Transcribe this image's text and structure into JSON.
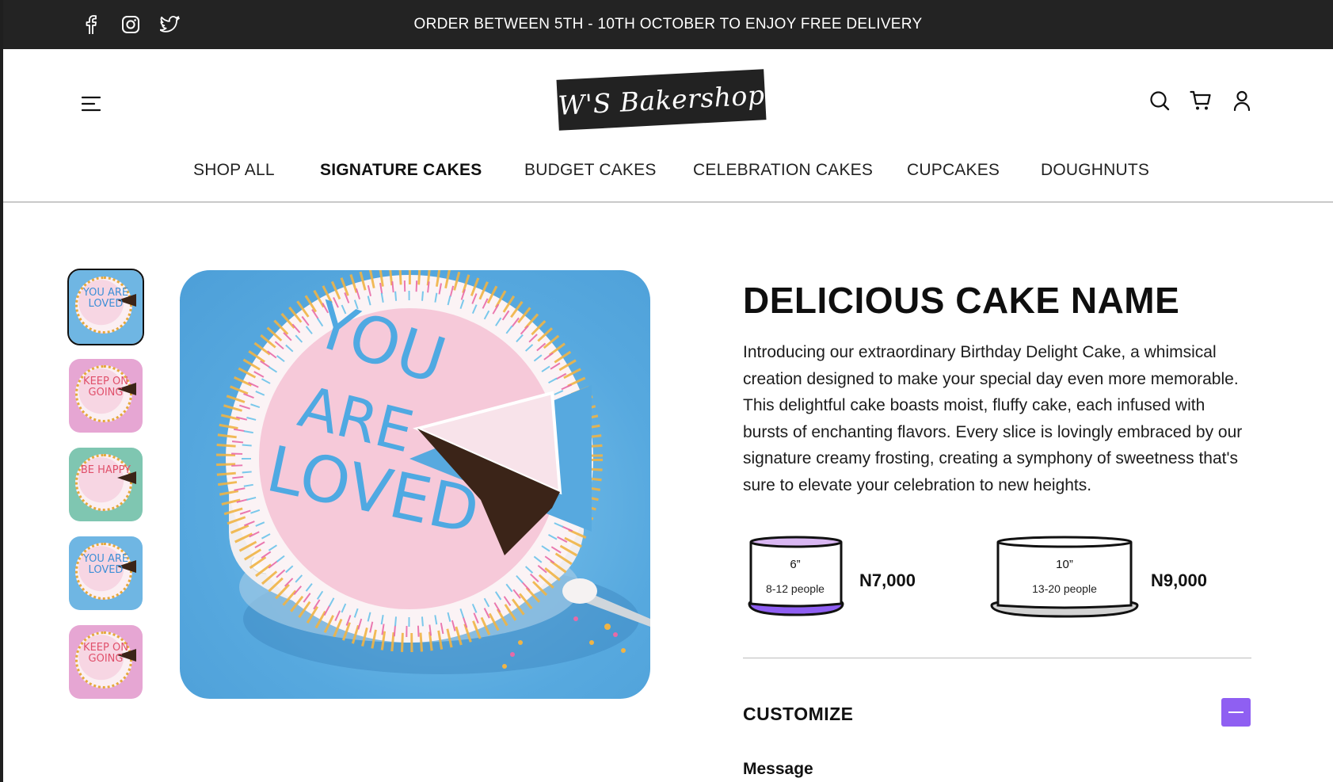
{
  "announcement": {
    "text": "ORDER BETWEEN 5TH - 10TH OCTOBER TO ENJOY FREE DELIVERY",
    "social_icons": [
      "facebook-icon",
      "instagram-icon",
      "twitter-icon"
    ]
  },
  "header": {
    "logo_text": "W'S Bakershop",
    "menu_icon": "hamburger-menu-icon",
    "action_icons": [
      "search-icon",
      "cart-icon",
      "user-icon"
    ]
  },
  "nav": {
    "items": [
      {
        "label": "SHOP ALL"
      },
      {
        "label": "SIGNATURE CAKES",
        "active": true
      },
      {
        "label": "BUDGET CAKES"
      },
      {
        "label": "CELEBRATION CAKES"
      },
      {
        "label": "CUPCAKES"
      },
      {
        "label": "DOUGHNUTS"
      }
    ]
  },
  "gallery": {
    "thumbnails": [
      {
        "text": "YOU ARE LOVED",
        "bg": "#6fb6e3",
        "selected": true
      },
      {
        "text": "KEEP ON GOING",
        "bg": "#e6a6d3",
        "selected": false
      },
      {
        "text": "BE HAPPY",
        "bg": "#7fc6b1",
        "selected": false
      },
      {
        "text": "YOU ARE LOVED",
        "bg": "#6fb6e3",
        "selected": false
      },
      {
        "text": "KEEP ON GOING",
        "bg": "#e6a6d3",
        "selected": false
      }
    ],
    "hero_text": "YOU ARE LOVED"
  },
  "product": {
    "title": "DELICIOUS CAKE NAME",
    "description_lines": [
      "Introducing our extraordinary Birthday Delight Cake, a whimsical",
      "creation designed to make your special day even more memorable.",
      "This delightful cake boasts moist, fluffy cake, each infused with",
      "bursts of enchanting flavors.  Every slice is lovingly embraced by our",
      "signature creamy frosting, creating a symphony of sweetness that's",
      "sure to elevate your celebration to new heights."
    ],
    "sizes": [
      {
        "inch": "6”",
        "people": "8-12 people",
        "price": "N7,000",
        "selected": true
      },
      {
        "inch": "10”",
        "people": "13-20 people",
        "price": "N9,000",
        "selected": false
      }
    ],
    "customize_label": "CUSTOMIZE",
    "message_label": "Message"
  },
  "colors": {
    "accent": "#8f5ff2",
    "topbar": "#232323"
  }
}
